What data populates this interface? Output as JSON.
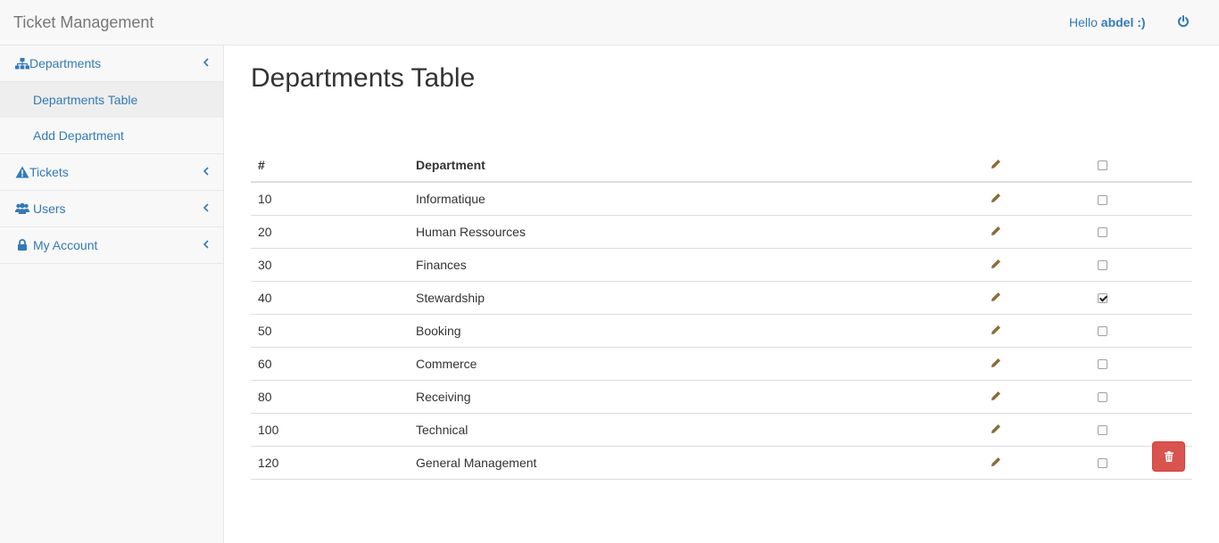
{
  "app": {
    "title": "Ticket Management"
  },
  "user": {
    "greeting_prefix": "Hello",
    "name": "abdel :)"
  },
  "sidebar": {
    "departments": {
      "label": "Departments",
      "icon": "sitemap-icon",
      "children": [
        {
          "label": "Departments Table",
          "active": true
        },
        {
          "label": "Add Department",
          "active": false
        }
      ]
    },
    "tickets": {
      "label": "Tickets",
      "icon": "warning-icon"
    },
    "users": {
      "label": "Users",
      "icon": "users-icon"
    },
    "account": {
      "label": "My Account",
      "icon": "lock-icon"
    }
  },
  "main": {
    "title": "Departments Table",
    "table": {
      "columns": [
        "#",
        "Department"
      ],
      "rows": [
        {
          "id": "10",
          "name": "Informatique",
          "checked": false
        },
        {
          "id": "20",
          "name": "Human Ressources",
          "checked": false
        },
        {
          "id": "30",
          "name": "Finances",
          "checked": false
        },
        {
          "id": "40",
          "name": "Stewardship",
          "checked": true
        },
        {
          "id": "50",
          "name": "Booking",
          "checked": false
        },
        {
          "id": "60",
          "name": "Commerce",
          "checked": false
        },
        {
          "id": "80",
          "name": "Receiving",
          "checked": false
        },
        {
          "id": "100",
          "name": "Technical",
          "checked": false
        },
        {
          "id": "120",
          "name": "General Management",
          "checked": false
        }
      ]
    },
    "delete_icon": "trash-icon"
  },
  "colors": {
    "link": "#337ab7",
    "danger": "#d9534f",
    "pencil": "#8a6d3b",
    "navbar_bg": "#f8f8f8"
  }
}
